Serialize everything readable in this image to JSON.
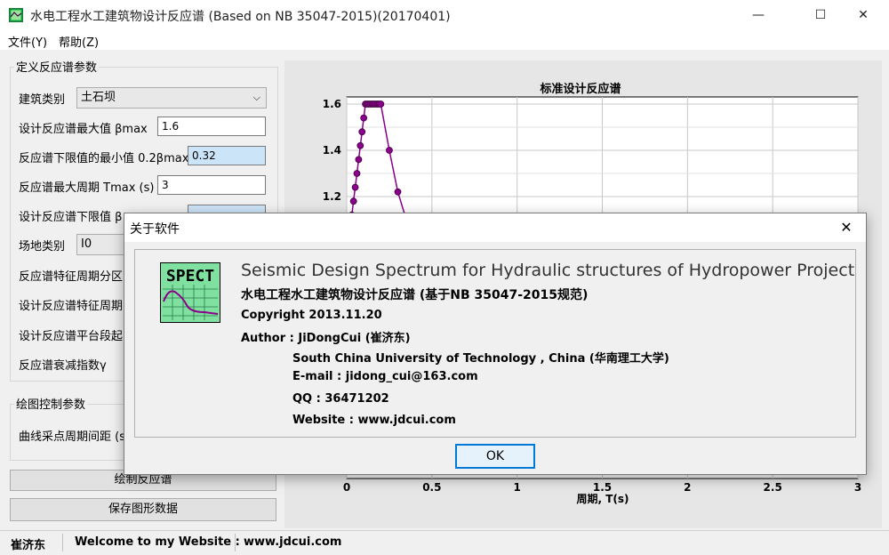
{
  "window": {
    "title": "水电工程水工建筑物设计反应谱 (Based on NB 35047-2015)(20170401)",
    "min_glyph": "—",
    "max_glyph": "☐",
    "close_glyph": "✕"
  },
  "menu": [
    {
      "label": "文件(Y)"
    },
    {
      "label": "帮助(Z)"
    }
  ],
  "params": {
    "title": "定义反应谱参数",
    "building_type_label": "建筑类别",
    "building_type_value": "土石坝",
    "beta_max_label": "设计反应谱最大值 βmax",
    "beta_max_value": "1.6",
    "min_lower_label": "反应谱下限值的最小值 0.2βmax",
    "min_lower_value": "0.32",
    "tmax_label": "反应谱最大周期 Tmax (s)",
    "tmax_value": "3",
    "lower_beta_label": "设计反应谱下限值 β",
    "site_type_label": "场地类别",
    "site_type_value": "I0",
    "char_period_zone_label": "反应谱特征周期分区",
    "char_period_label": "设计反应谱特征周期",
    "plateau_label": "设计反应谱平台段起",
    "decay_label": "反应谱衰减指数γ"
  },
  "plot_ctrl": {
    "title": "绘图控制参数",
    "sample_interval_label": "曲线采点周期间距 (s"
  },
  "buttons": {
    "draw": "绘制反应谱",
    "save": "保存图形数据"
  },
  "status": {
    "author": "崔济东",
    "welcome": "Welcome to my Website :",
    "site": "www.jdcui.com"
  },
  "chart_data": {
    "type": "line",
    "title": "标准设计反应谱",
    "xlabel": "周期, T(s)",
    "ylabel": "",
    "xlim": [
      0,
      3
    ],
    "ylim_visible": [
      1.0,
      1.6
    ],
    "x_ticks": [
      "0",
      "0.5",
      "1",
      "1.5",
      "2",
      "2.5",
      "3"
    ],
    "y_ticks": [
      "1.2",
      "1.4",
      "1.6"
    ],
    "grid": true,
    "line_color": "#8b008b",
    "series": [
      {
        "x": [
          0.02,
          0.03,
          0.04,
          0.05,
          0.06,
          0.07,
          0.08,
          0.09,
          0.1,
          0.11,
          0.12,
          0.13,
          0.14,
          0.15,
          0.16,
          0.17,
          0.18,
          0.19,
          0.2,
          0.25,
          0.3,
          0.35
        ],
        "values": [
          1.06,
          1.12,
          1.18,
          1.24,
          1.3,
          1.36,
          1.42,
          1.48,
          1.54,
          1.6,
          1.6,
          1.6,
          1.6,
          1.6,
          1.6,
          1.6,
          1.6,
          1.6,
          1.6,
          1.4,
          1.22,
          1.1
        ]
      }
    ]
  },
  "about": {
    "title": "关于软件",
    "close_glyph": "✕",
    "logo_text": "SPECT",
    "heading_en": "Seismic Design Spectrum for Hydraulic structures of Hydropower Project",
    "heading_cn": "水电工程水工建筑物设计反应谱 (基于NB 35047-2015规范)",
    "copyright": "Copyright 2013.11.20",
    "author": "Author : JiDongCui (崔济东)",
    "university": "South China University of Technology , China (华南理工大学)",
    "email": "E-mail : jidong_cui@163.com",
    "qq": "QQ : 36471202",
    "website": "Website :  www.jdcui.com",
    "ok": "OK"
  }
}
